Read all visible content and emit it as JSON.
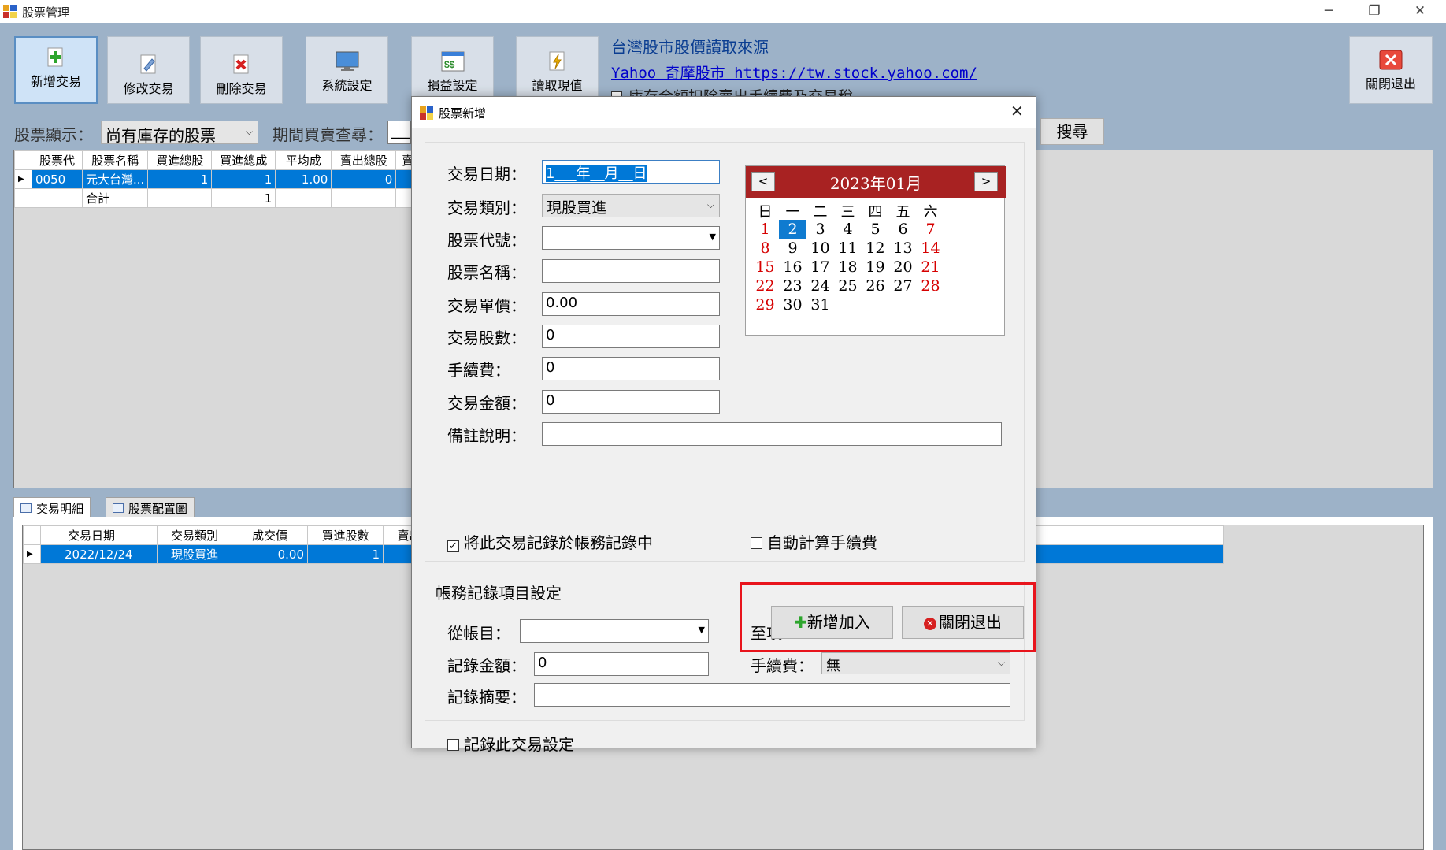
{
  "window": {
    "title": "股票管理",
    "controls": {
      "minimize": "─",
      "restore": "❐",
      "close": "✕"
    }
  },
  "toolbar": {
    "add": "新增交易",
    "edit": "修改交易",
    "delete": "刪除交易",
    "settings": "系統設定",
    "pnl": "損益設定",
    "read_price": "讀取現值",
    "close": "關閉退出"
  },
  "source": {
    "heading": "台灣股市股價讀取來源",
    "link": "Yahoo 奇摩股市 https://tw.stock.yahoo.com/",
    "partial_checkbox": "庫存金額扣除賣出手續費及交易稅"
  },
  "filter": {
    "label": "股票顯示：",
    "value": "尚有庫存的股票",
    "period_label": "期間買賣查尋：",
    "period_value": "___",
    "search": "搜尋"
  },
  "stock_grid": {
    "headers": [
      "股票代",
      "股票名稱",
      "買進總股",
      "買進總成",
      "平均成",
      "賣出總股",
      "賣"
    ],
    "rows": [
      [
        "0050",
        "元大台灣...",
        "1",
        "1",
        "1.00",
        "0",
        ""
      ],
      [
        "",
        "合計",
        "",
        "1",
        "",
        "",
        ""
      ]
    ]
  },
  "tabs": {
    "detail": "交易明細",
    "allocation": "股票配置圖"
  },
  "detail_grid": {
    "headers": [
      "交易日期",
      "交易類別",
      "成交價",
      "買進股數",
      "賣出股數"
    ],
    "rows": [
      [
        "2022/12/24",
        "現股買進",
        "0.00",
        "1",
        ""
      ]
    ]
  },
  "dialog": {
    "title": "股票新增",
    "close": "✕",
    "fields": {
      "date_label": "交易日期：",
      "date_value": "1___年__月__日",
      "type_label": "交易類別：",
      "type_value": "現股買進",
      "code_label": "股票代號：",
      "code_value": "",
      "name_label": "股票名稱：",
      "name_value": "",
      "price_label": "交易單價：",
      "price_value": "0.00",
      "shares_label": "交易股數：",
      "shares_value": "0",
      "fee_label": "手續費：",
      "fee_value": "0",
      "amount_label": "交易金額：",
      "amount_value": "0",
      "note_label": "備註說明：",
      "note_value": ""
    },
    "calendar": {
      "prev": "<",
      "next": ">",
      "month": "2023年01月",
      "weekdays": [
        "日",
        "一",
        "二",
        "三",
        "四",
        "五",
        "六"
      ],
      "selected_day": 2
    },
    "record_check": "將此交易記錄於帳務記錄中",
    "auto_fee_check": "自動計算手續費",
    "ledger": {
      "title": "帳務記錄項目設定",
      "from_label": "從帳目：",
      "from_value": "",
      "to_label": "至項",
      "amount_label": "記錄金額：",
      "amount_value": "0",
      "fee_label": "手續費：",
      "fee_value": "無",
      "summary_label": "記錄摘要：",
      "summary_value": ""
    },
    "add_button": "新增加入",
    "close_button": "關閉退出",
    "save_setting_check": "記錄此交易設定"
  },
  "colors": {
    "background": "#9db2c8",
    "selection": "#0078d7",
    "calendar_header": "#a82222",
    "highlight_box": "#e8141c"
  }
}
